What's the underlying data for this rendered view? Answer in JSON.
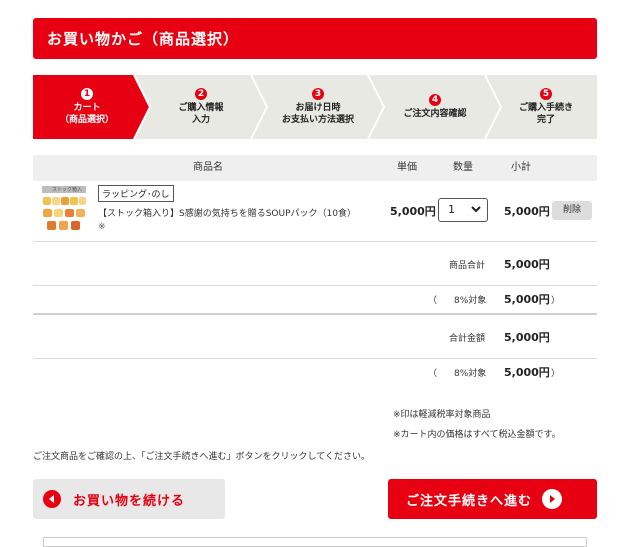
{
  "header": {
    "title": "お買い物かご（商品選択）"
  },
  "steps": [
    {
      "num": "1",
      "line1": "カート",
      "line2": "（商品選択）",
      "active": true
    },
    {
      "num": "2",
      "line1": "ご購入情報",
      "line2": "入力",
      "active": false
    },
    {
      "num": "3",
      "line1": "お届け日時",
      "line2": "お支払い方法選択",
      "active": false
    },
    {
      "num": "4",
      "line1": "ご注文内容確認",
      "line2": "",
      "active": false
    },
    {
      "num": "5",
      "line1": "ご購入手続き",
      "line2": "完了",
      "active": false
    }
  ],
  "table": {
    "headers": {
      "product": "商品名",
      "unit_price": "単価",
      "qty": "数量",
      "subtotal": "小計"
    }
  },
  "item": {
    "thumb_label": "ストック箱入",
    "wrap_label": "ラッピング･のし",
    "name": "【ストック箱入り】S感謝の気持ちを贈るSOUPパック（10食）",
    "mark": "※",
    "unit_price": "5,000円",
    "qty": "1",
    "subtotal": "5,000円",
    "delete_label": "削除"
  },
  "summary": {
    "goods_total_label": "商品合計",
    "goods_total": "5,000円",
    "tax1_open": "（",
    "tax1_label": "8%対象",
    "tax1_value": "5,000円",
    "tax1_close": "）",
    "grand_total_label": "合計金額",
    "grand_total": "5,000円",
    "tax2_open": "（",
    "tax2_label": "8%対象",
    "tax2_value": "5,000円",
    "tax2_close": "）"
  },
  "notes": {
    "reduced_tax": "※印は軽減税率対象商品",
    "tax_included": "※カート内の価格はすべて税込金額です。",
    "instruction": "ご注文商品をご確認の上、「ご注文手続きへ進む」ボタンをクリックしてください。"
  },
  "buttons": {
    "continue_shopping": "お買い物を続ける",
    "proceed": "ご注文手続きへ進む"
  },
  "colors": {
    "accent": "#e60012",
    "step_bg": "#e9e9e3",
    "header_row": "#efefef"
  }
}
